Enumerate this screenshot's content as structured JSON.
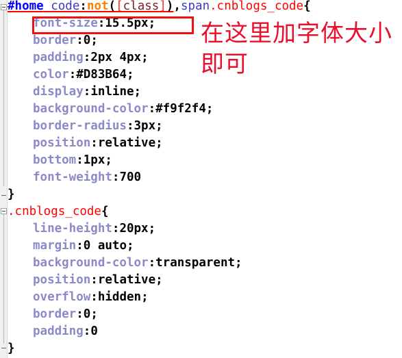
{
  "editor": {
    "language": "css",
    "background_color": "#ffffff",
    "gutter_color": "#f0f0f0",
    "font_family_hint": "monospace"
  },
  "colors": {
    "id_selector": "#0000ff",
    "element_selector": "#3b3bc8",
    "pseudo_class": "#ff8000",
    "attribute_selector": "#ff2a2a",
    "class_selector": "#ff0000",
    "property_name": "#8a8ac8",
    "value": "#000000",
    "annotation_red": "#e8112d",
    "highlight_border": "#ee1111"
  },
  "annotation": {
    "text": "在这里加字体大小\n即可",
    "line1": "在这里加字体大小",
    "line2": "即可"
  },
  "highlight": {
    "target_line": "font-size:15.5px;",
    "note": "red rectangle drawn around the font-size declaration"
  },
  "code": {
    "rules": [
      {
        "selector_parts": [
          {
            "text": "#home",
            "token": "id"
          },
          {
            "text": " ",
            "token": "plain"
          },
          {
            "text": "code",
            "token": "tag"
          },
          {
            "text": ":",
            "token": "punct"
          },
          {
            "text": "not",
            "token": "pseudo"
          },
          {
            "text": "(",
            "token": "punct"
          },
          {
            "text": "[",
            "token": "attr"
          },
          {
            "text": "class",
            "token": "attrname"
          },
          {
            "text": "]",
            "token": "attr"
          },
          {
            "text": ")",
            "token": "punct"
          },
          {
            "text": ",",
            "token": "comma"
          },
          {
            "text": "span",
            "token": "tag"
          },
          {
            "text": ".cnblogs_code",
            "token": "class"
          },
          {
            "text": "{",
            "token": "brace"
          }
        ],
        "selector_text": "#home code:not([class]),span.cnblogs_code{",
        "declarations": [
          {
            "property": "font-size",
            "value": "15.5px",
            "terminator": ";",
            "highlighted": true
          },
          {
            "property": "border",
            "value": "0",
            "terminator": ";",
            "highlighted": false
          },
          {
            "property": "padding",
            "value": "2px 4px",
            "terminator": ";",
            "highlighted": false
          },
          {
            "property": "color",
            "value": "#D83B64",
            "terminator": ";",
            "highlighted": false
          },
          {
            "property": "display",
            "value": "inline",
            "terminator": ";",
            "highlighted": false
          },
          {
            "property": "background-color",
            "value": "#f9f2f4",
            "terminator": ";",
            "highlighted": false
          },
          {
            "property": "border-radius",
            "value": "3px",
            "terminator": ";",
            "highlighted": false
          },
          {
            "property": "position",
            "value": "relative",
            "terminator": ";",
            "highlighted": false
          },
          {
            "property": "bottom",
            "value": "1px",
            "terminator": ";",
            "highlighted": false
          },
          {
            "property": "font-weight",
            "value": "700",
            "terminator": "",
            "highlighted": false
          }
        ],
        "closing_brace": "}"
      },
      {
        "selector_parts": [
          {
            "text": ".cnblogs_code",
            "token": "class"
          },
          {
            "text": "{",
            "token": "brace"
          }
        ],
        "selector_text": ".cnblogs_code{",
        "declarations": [
          {
            "property": "line-height",
            "value": "20px",
            "terminator": ";",
            "highlighted": false
          },
          {
            "property": "margin",
            "value": "0 auto",
            "terminator": ";",
            "highlighted": false
          },
          {
            "property": "background-color",
            "value": "transparent",
            "terminator": ";",
            "highlighted": false
          },
          {
            "property": "position",
            "value": "relative",
            "terminator": ";",
            "highlighted": false
          },
          {
            "property": "overflow",
            "value": "hidden",
            "terminator": ";",
            "highlighted": false
          },
          {
            "property": "border",
            "value": "0",
            "terminator": ";",
            "highlighted": false
          },
          {
            "property": "padding",
            "value": "0",
            "terminator": "",
            "highlighted": false
          }
        ],
        "closing_brace": "}"
      }
    ]
  },
  "gutter": {
    "markers": [
      {
        "type": "fold-open",
        "label": "collapse-rule-1"
      },
      {
        "type": "fold-end",
        "label": "end-rule-1"
      },
      {
        "type": "fold-open",
        "label": "collapse-rule-2"
      },
      {
        "type": "fold-end",
        "label": "end-rule-2"
      }
    ]
  }
}
